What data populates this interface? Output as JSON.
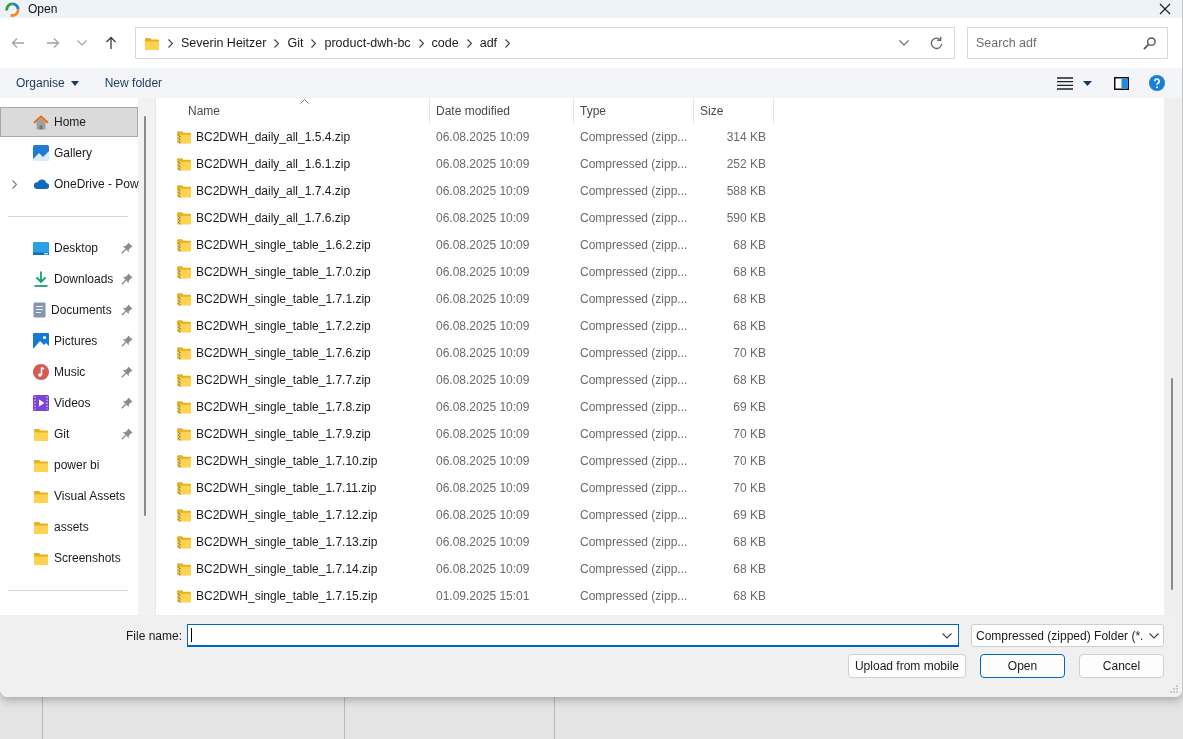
{
  "window": {
    "title": "Open"
  },
  "navigation": {
    "back": {
      "disabled": true
    },
    "forward": {
      "disabled": true
    },
    "recent": {
      "disabled": true
    },
    "up": {
      "disabled": false
    }
  },
  "address_bar": {
    "path": [
      "Severin Heitzer",
      "Git",
      "product-dwh-bc",
      "code",
      "adf"
    ]
  },
  "search": {
    "placeholder": "Search adf"
  },
  "toolbar": {
    "buttons": [
      {
        "label": "Organise",
        "kind": "menu"
      },
      {
        "label": "New folder",
        "kind": "action"
      }
    ]
  },
  "sidebar": {
    "sections": [
      {
        "items": [
          {
            "label": "Home",
            "kind": "home",
            "selected": true,
            "pinned": false
          },
          {
            "label": "Gallery",
            "kind": "gallery",
            "selected": false,
            "pinned": false
          },
          {
            "label": "OneDrive - Pow",
            "kind": "cloud",
            "selected": false,
            "pinned": false,
            "expanded": false
          }
        ]
      },
      {
        "items": [
          {
            "label": "Desktop",
            "kind": "desktop",
            "selected": false,
            "pinned": true
          },
          {
            "label": "Downloads",
            "kind": "download",
            "selected": false,
            "pinned": true
          },
          {
            "label": "Documents",
            "kind": "documents",
            "selected": false,
            "pinned": true
          },
          {
            "label": "Pictures",
            "kind": "pictures",
            "selected": false,
            "pinned": true
          },
          {
            "label": "Music",
            "kind": "music",
            "selected": false,
            "pinned": true
          },
          {
            "label": "Videos",
            "kind": "videos",
            "selected": false,
            "pinned": true
          },
          {
            "label": "Git",
            "kind": "folder",
            "selected": false,
            "pinned": true
          },
          {
            "label": "power bi",
            "kind": "folder",
            "selected": false,
            "pinned": false
          },
          {
            "label": "Visual Assets",
            "kind": "folder",
            "selected": false,
            "pinned": false
          },
          {
            "label": "assets",
            "kind": "folder",
            "selected": false,
            "pinned": false
          },
          {
            "label": "Screenshots",
            "kind": "folder",
            "selected": false,
            "pinned": false
          }
        ]
      }
    ]
  },
  "file_list": {
    "columns": [
      {
        "label": "Name",
        "sorted": true
      },
      {
        "label": "Date modified",
        "sorted": false
      },
      {
        "label": "Type",
        "sorted": false
      },
      {
        "label": "Size",
        "sorted": false
      }
    ],
    "rows": [
      {
        "name": "BC2DWH_daily_all_1.5.4.zip",
        "date_modified": "06.08.2025 10:09",
        "type": "Compressed (zipp...",
        "size": "314 KB"
      },
      {
        "name": "BC2DWH_daily_all_1.6.1.zip",
        "date_modified": "06.08.2025 10:09",
        "type": "Compressed (zipp...",
        "size": "252 KB"
      },
      {
        "name": "BC2DWH_daily_all_1.7.4.zip",
        "date_modified": "06.08.2025 10:09",
        "type": "Compressed (zipp...",
        "size": "588 KB"
      },
      {
        "name": "BC2DWH_daily_all_1.7.6.zip",
        "date_modified": "06.08.2025 10:09",
        "type": "Compressed (zipp...",
        "size": "590 KB"
      },
      {
        "name": "BC2DWH_single_table_1.6.2.zip",
        "date_modified": "06.08.2025 10:09",
        "type": "Compressed (zipp...",
        "size": "68 KB"
      },
      {
        "name": "BC2DWH_single_table_1.7.0.zip",
        "date_modified": "06.08.2025 10:09",
        "type": "Compressed (zipp...",
        "size": "68 KB"
      },
      {
        "name": "BC2DWH_single_table_1.7.1.zip",
        "date_modified": "06.08.2025 10:09",
        "type": "Compressed (zipp...",
        "size": "68 KB"
      },
      {
        "name": "BC2DWH_single_table_1.7.2.zip",
        "date_modified": "06.08.2025 10:09",
        "type": "Compressed (zipp...",
        "size": "68 KB"
      },
      {
        "name": "BC2DWH_single_table_1.7.6.zip",
        "date_modified": "06.08.2025 10:09",
        "type": "Compressed (zipp...",
        "size": "70 KB"
      },
      {
        "name": "BC2DWH_single_table_1.7.7.zip",
        "date_modified": "06.08.2025 10:09",
        "type": "Compressed (zipp...",
        "size": "68 KB"
      },
      {
        "name": "BC2DWH_single_table_1.7.8.zip",
        "date_modified": "06.08.2025 10:09",
        "type": "Compressed (zipp...",
        "size": "69 KB"
      },
      {
        "name": "BC2DWH_single_table_1.7.9.zip",
        "date_modified": "06.08.2025 10:09",
        "type": "Compressed (zipp...",
        "size": "70 KB"
      },
      {
        "name": "BC2DWH_single_table_1.7.10.zip",
        "date_modified": "06.08.2025 10:09",
        "type": "Compressed (zipp...",
        "size": "70 KB"
      },
      {
        "name": "BC2DWH_single_table_1.7.11.zip",
        "date_modified": "06.08.2025 10:09",
        "type": "Compressed (zipp...",
        "size": "70 KB"
      },
      {
        "name": "BC2DWH_single_table_1.7.12.zip",
        "date_modified": "06.08.2025 10:09",
        "type": "Compressed (zipp...",
        "size": "69 KB"
      },
      {
        "name": "BC2DWH_single_table_1.7.13.zip",
        "date_modified": "06.08.2025 10:09",
        "type": "Compressed (zipp...",
        "size": "68 KB"
      },
      {
        "name": "BC2DWH_single_table_1.7.14.zip",
        "date_modified": "06.08.2025 10:09",
        "type": "Compressed (zipp...",
        "size": "68 KB"
      },
      {
        "name": "BC2DWH_single_table_1.7.15.zip",
        "date_modified": "01.09.2025 15:01",
        "type": "Compressed (zipp...",
        "size": "68 KB"
      }
    ]
  },
  "footer": {
    "file_name": {
      "label": "File name:",
      "focused": true
    },
    "file_type": {
      "value": "Compressed (zipped) Folder (*."
    },
    "buttons": [
      {
        "label": "Upload from mobile",
        "default": false
      },
      {
        "label": "Open",
        "default": true
      },
      {
        "label": "Cancel",
        "default": false
      }
    ]
  }
}
